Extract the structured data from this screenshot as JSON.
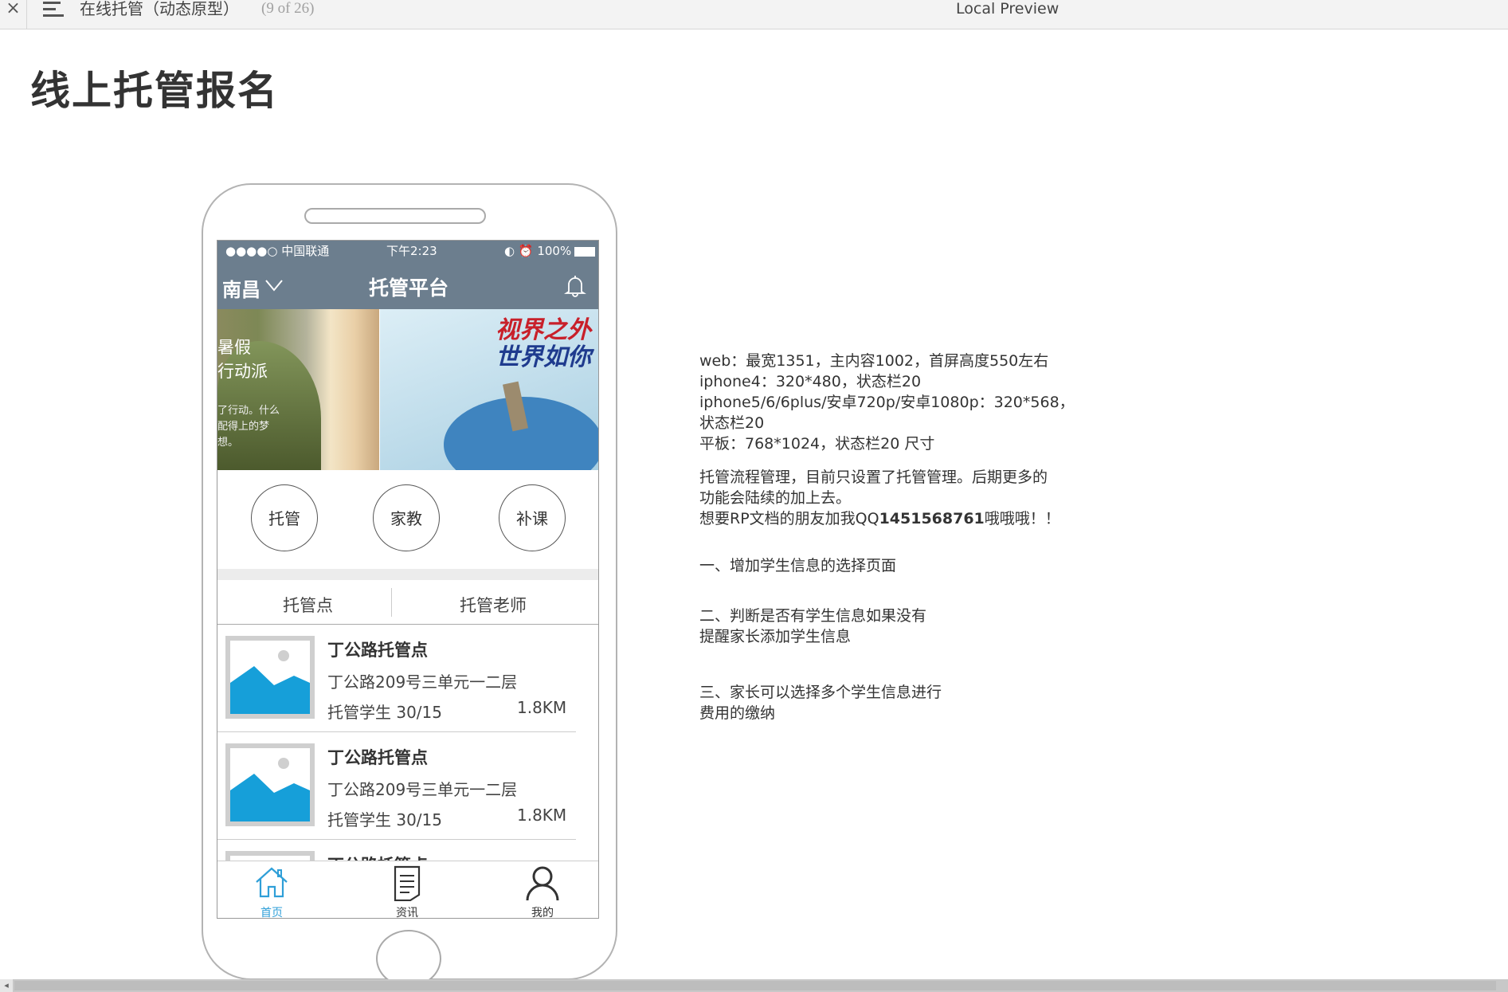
{
  "toolbar": {
    "close_glyph": "×",
    "doc_title": "在线托管（动态原型）",
    "page_indicator": "(9 of 26)",
    "preview_label": "Local Preview"
  },
  "heading": "线上托管报名",
  "phone": {
    "status": {
      "carrier": "●●●●○ 中国联通",
      "time": "下午2:23",
      "battery": "100%"
    },
    "nav": {
      "city": "南昌",
      "title": "托管平台"
    },
    "banner": {
      "left_line1": "暑假",
      "left_line2": "行动派",
      "left_small": "了行动。什么配得上的梦想。",
      "right_text_a": "视界之外",
      "right_text_b": "世界如你"
    },
    "circles": [
      "托管",
      "家教",
      "补课"
    ],
    "tabs": [
      "托管点",
      "托管老师"
    ],
    "items": [
      {
        "name": "丁公路托管点",
        "address": "丁公路209号三单元一二层",
        "students": "托管学生  30/15",
        "distance": "1.8KM"
      },
      {
        "name": "丁公路托管点",
        "address": "丁公路209号三单元一二层",
        "students": "托管学生  30/15",
        "distance": "1.8KM"
      },
      {
        "name": "丁公路托管点",
        "address": "",
        "students": "",
        "distance": ""
      }
    ],
    "tabbar": [
      {
        "label": "首页",
        "icon": "home-icon",
        "active": true
      },
      {
        "label": "资讯",
        "icon": "document-icon",
        "active": false
      },
      {
        "label": "我的",
        "icon": "user-icon",
        "active": false
      }
    ]
  },
  "notes": {
    "line1": "web：最宽1351，主内容1002，首屏高度550左右",
    "line2": "iphone4：320*480，状态栏20",
    "line3": "iphone5/6/6plus/安卓720p/安卓1080p：320*568，",
    "line4": "状态栏20",
    "line5": "平板：768*1024，状态栏20  尺寸",
    "para2_line1": "托管流程管理，目前只设置了托管管理。后期更多的",
    "para2_line2": "功能会陆续的加上去。",
    "para2_line3_pre": "想要RP文档的朋友加我QQ",
    "para2_line3_qq": "1451568761",
    "para2_line3_post": "哦哦哦！！",
    "step1": "一、增加学生信息的选择页面",
    "step2_line1": "二、判断是否有学生信息如果没有",
    "step2_line2": "提醒家长添加学生信息",
    "step3_line1": "三、家长可以选择多个学生信息进行",
    "step3_line2": "费用的缴纳"
  },
  "colors": {
    "nav_bg": "#6c7e8e",
    "accent": "#2f9fd8",
    "placeholder_blue": "#169fd9"
  }
}
